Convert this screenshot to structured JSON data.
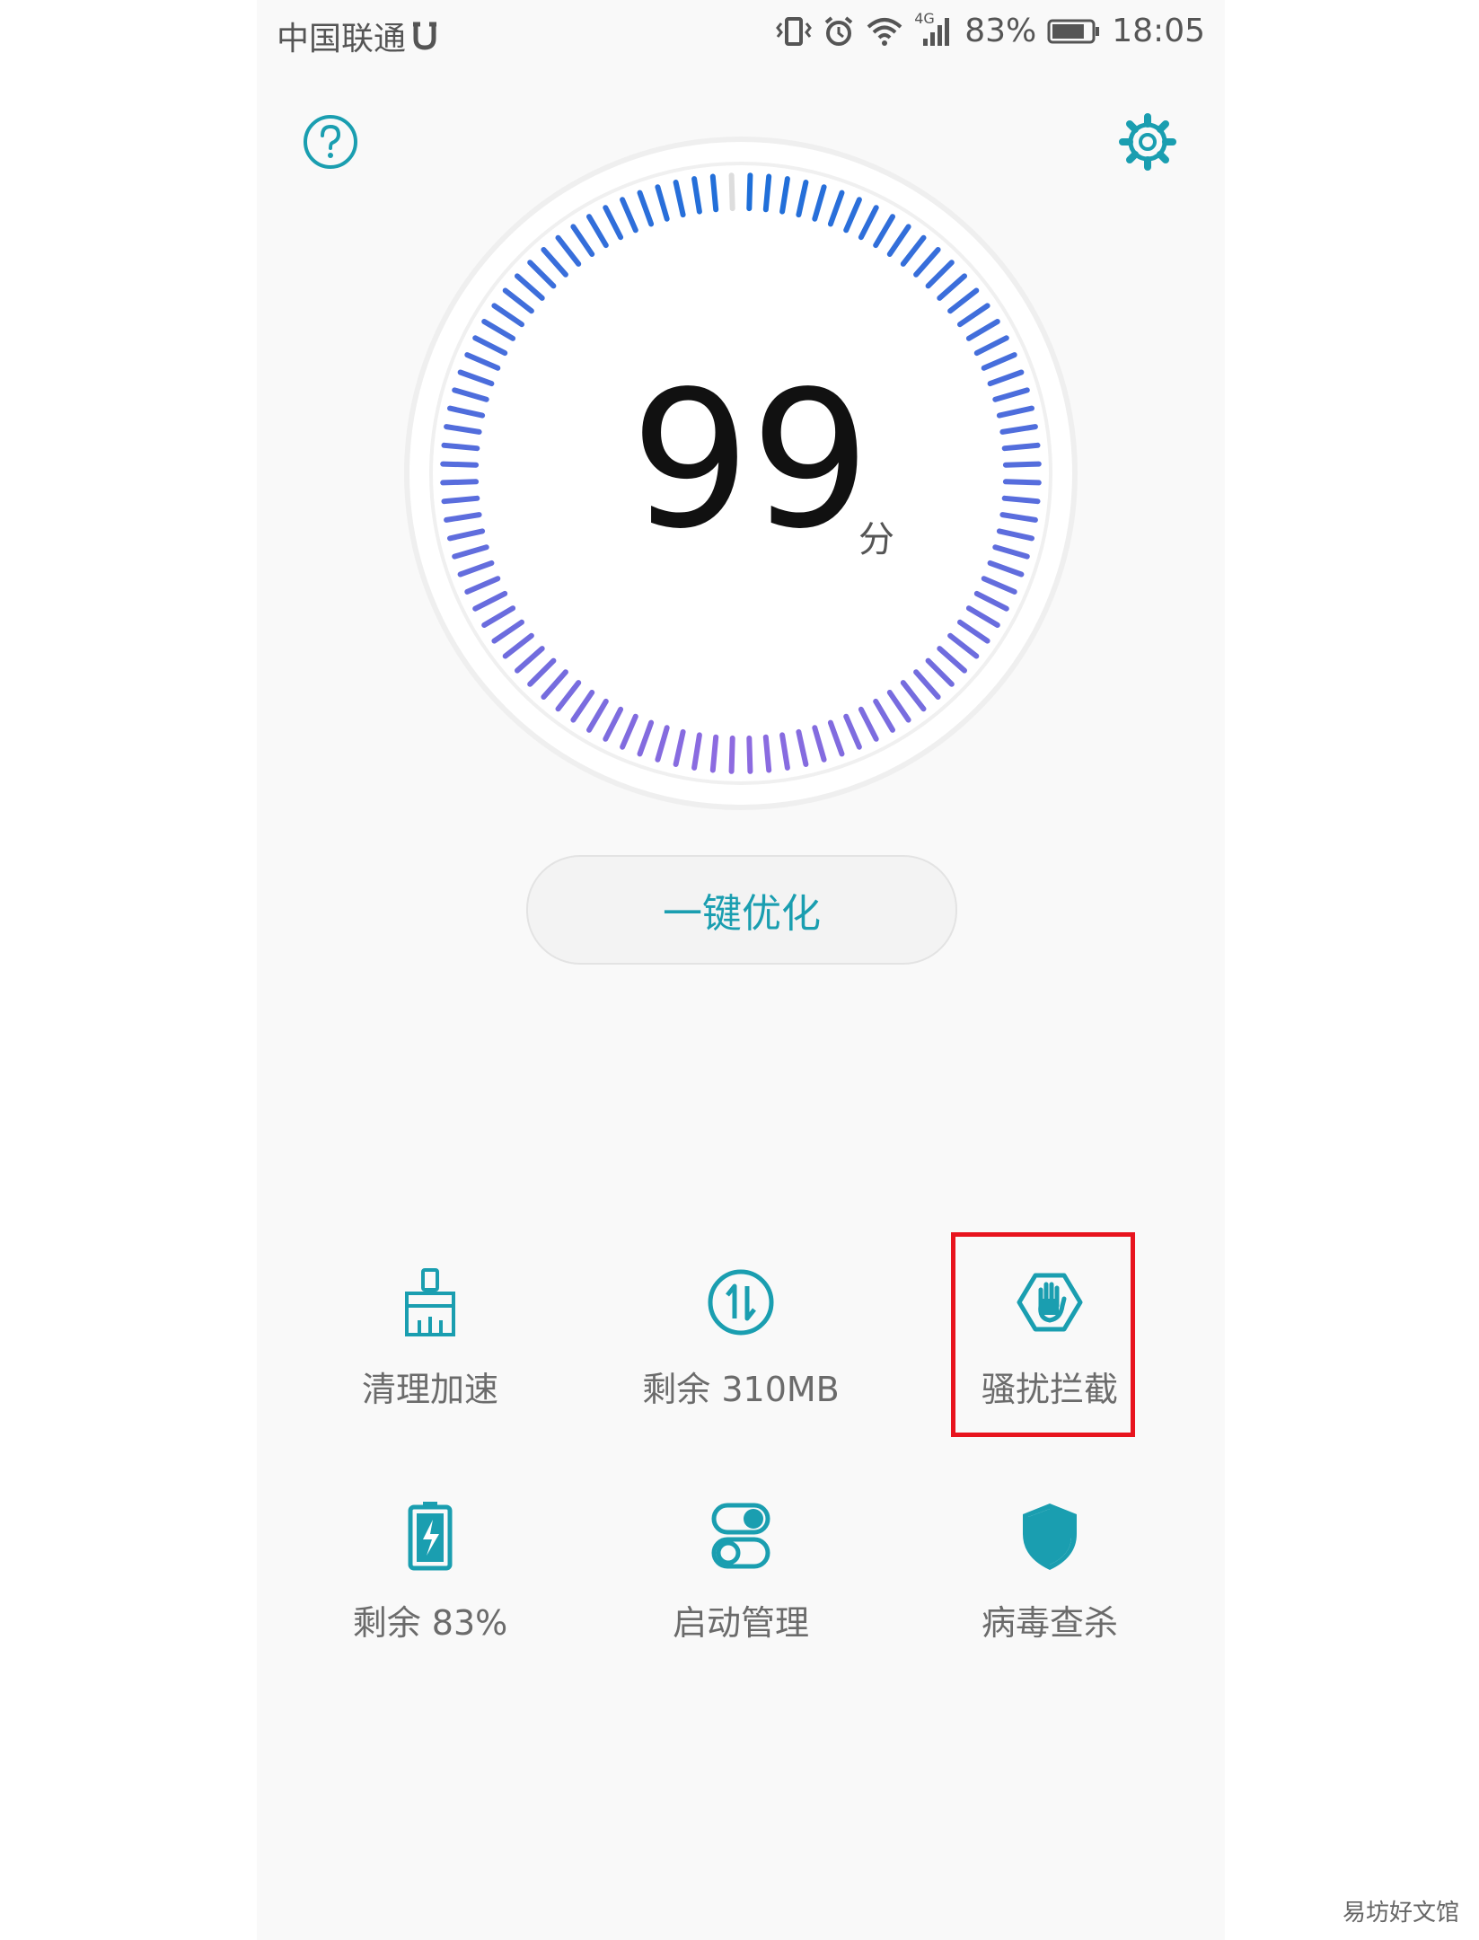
{
  "status_bar": {
    "carrier": "中国联通",
    "network_badge": "4G",
    "battery_percent": "83%",
    "battery_level": 0.83,
    "time": "18:05",
    "icons": [
      "notification-u-icon",
      "vibrate-icon",
      "alarm-icon",
      "wifi-icon",
      "signal-icon",
      "battery-icon"
    ]
  },
  "header": {
    "help_icon": "help-icon",
    "settings_icon": "gear-icon"
  },
  "score": {
    "value": "99",
    "unit": "分",
    "max": 100,
    "ring_colors": {
      "start": "#1e6fd9",
      "end": "#8e6be0",
      "empty": "#dddddd"
    }
  },
  "optimize_button": {
    "label": "一键优化"
  },
  "tools": [
    {
      "label": "清理加速",
      "icon": "broom-icon"
    },
    {
      "label": "剩余 310MB",
      "icon": "transfer-arrows-icon"
    },
    {
      "label": "骚扰拦截",
      "icon": "stop-hand-icon"
    },
    {
      "label": "剩余 83%",
      "icon": "battery-charging-icon"
    },
    {
      "label": "启动管理",
      "icon": "toggle-switches-icon"
    },
    {
      "label": "病毒查杀",
      "icon": "shield-icon"
    }
  ],
  "highlight": {
    "target": "骚扰拦截",
    "color": "#e8141e"
  },
  "accent_color": "#1a9eb0",
  "watermark": "易坊好文馆"
}
